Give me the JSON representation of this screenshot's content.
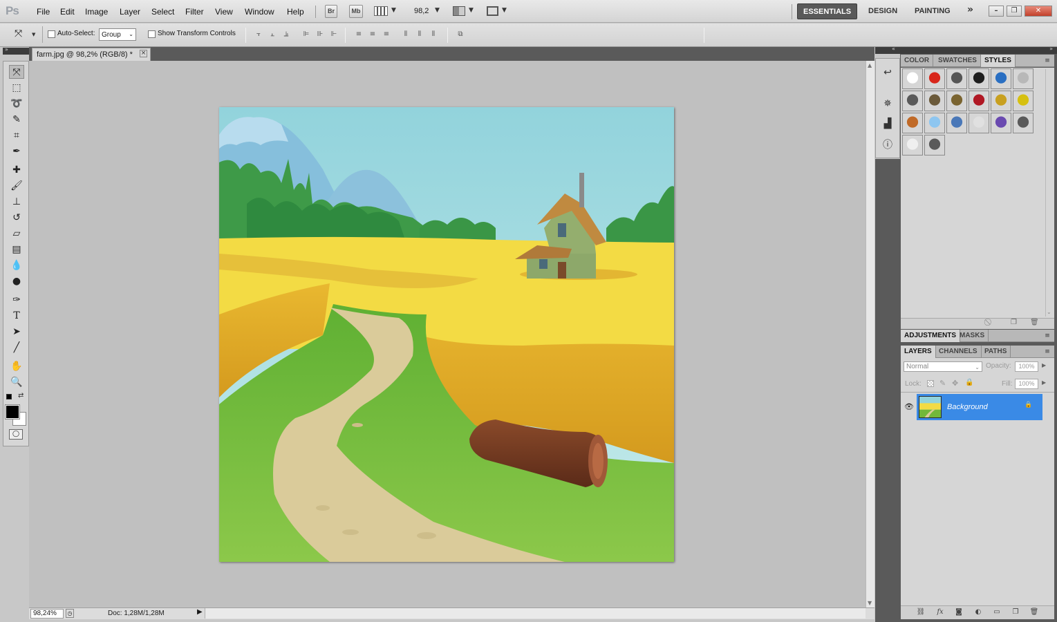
{
  "app": {
    "logo": "Ps"
  },
  "menu": [
    "File",
    "Edit",
    "Image",
    "Layer",
    "Select",
    "Filter",
    "View",
    "Window",
    "Help"
  ],
  "appbar": {
    "bridge": "Br",
    "minibridge": "Mb",
    "zoom": "98,2"
  },
  "workspaces": [
    "ESSENTIALS",
    "DESIGN",
    "PAINTING"
  ],
  "workspace_more": "»",
  "window_buttons": {
    "minimize": "–",
    "restore": "❐",
    "close": "✕"
  },
  "options": {
    "auto_select_label": "Auto-Select:",
    "auto_select_value": "Group",
    "show_transform_label": "Show Transform Controls"
  },
  "document": {
    "tab_title": "farm.jpg @ 98,2% (RGB/8) *",
    "close_glyph": "×",
    "zoom_status": "98,24%",
    "doc_info": "Doc: 1,28M/1,28M"
  },
  "panels": {
    "top_tabs": [
      "COLOR",
      "SWATCHES",
      "STYLES"
    ],
    "top_active": "STYLES",
    "mid_tabs": [
      "ADJUSTMENTS",
      "MASKS"
    ],
    "layer_tabs": [
      "LAYERS",
      "CHANNELS",
      "PATHS"
    ],
    "blend_mode": "Normal",
    "opacity_label": "Opacity:",
    "opacity_value": "100%",
    "lock_label": "Lock:",
    "fill_label": "Fill:",
    "fill_value": "100%",
    "layer_name": "Background"
  },
  "style_swatches": [
    "#ffffff",
    "#d8261a",
    "#555555",
    "#1f1f1f",
    "#2a6fc2",
    "#b8b8b8",
    "#5a5a5a",
    "#6b5a3a",
    "#7a6430",
    "#b01824",
    "#c8a020",
    "#d6c010",
    "#c06a28",
    "#8ec6f0",
    "#4a78b8",
    "#e0e0e0",
    "#6a4ab0",
    "#5a5a5a",
    "#efefef",
    "#5a5a5a"
  ],
  "colors": {
    "accent": "#3a8ae6",
    "sky_top": "#8fd0dc",
    "wheat": "#f4dd45",
    "grass": "#72b83a",
    "path": "#d9c998"
  }
}
